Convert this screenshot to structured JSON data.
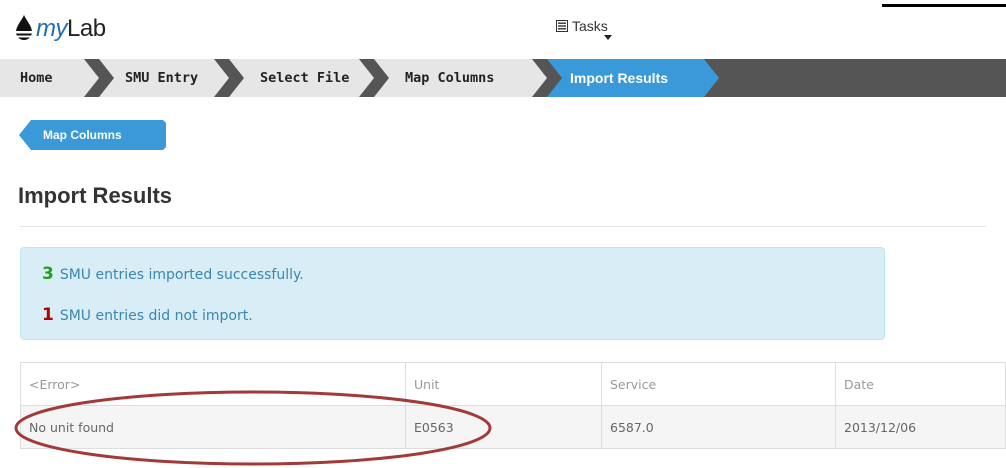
{
  "app": {
    "logo_prefix": "my",
    "logo_suffix": "Lab",
    "tasks_label": "Tasks"
  },
  "breadcrumb": [
    {
      "label": "Home"
    },
    {
      "label": "SMU Entry"
    },
    {
      "label": "Select File"
    },
    {
      "label": "Map Columns"
    },
    {
      "label": "Import Results",
      "active": true
    }
  ],
  "back_button": {
    "label": "Map Columns"
  },
  "page": {
    "title": "Import Results"
  },
  "alert": {
    "success_count": "3",
    "success_text": "SMU entries imported successfully.",
    "fail_count": "1",
    "fail_text": "SMU entries did not import."
  },
  "table": {
    "headers": [
      "<Error>",
      "Unit",
      "Service",
      "Date"
    ],
    "rows": [
      [
        "No unit found",
        "E0563",
        "6587.0",
        "2013/12/06"
      ]
    ]
  },
  "colors": {
    "breadcrumb_bg": "#555555",
    "crumb_bg": "#e6e6e6",
    "active_crumb": "#3a9ad9",
    "alert_bg": "#d9edf7",
    "alert_text": "#3a87ad",
    "success_count": "#21a121",
    "fail_count": "#b30000",
    "annotation": "#a33a3a"
  },
  "icons": {
    "logo": "drop-icon",
    "tasks": "list-icon",
    "caret": "caret-down-icon"
  }
}
